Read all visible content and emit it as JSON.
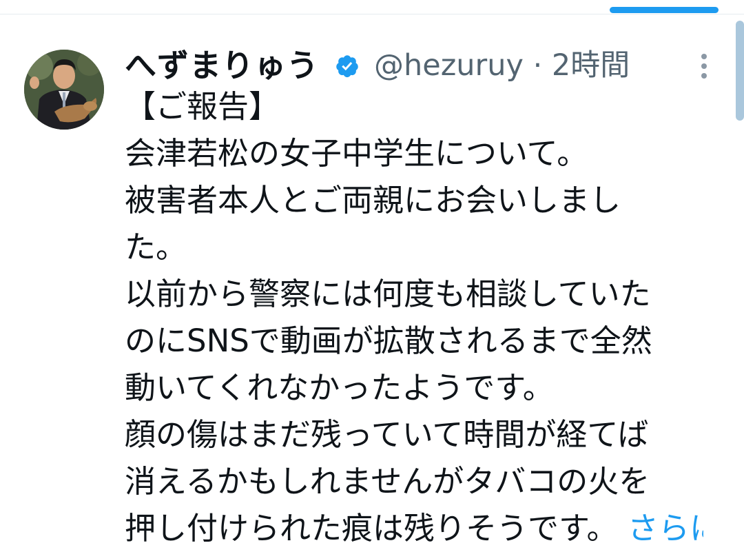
{
  "tweet": {
    "author_name": "へずまりゅう",
    "handle_time": "@hezuruy · 2時間",
    "lines": [
      "【ご報告】",
      "会津若松の女子中学生について。",
      "被害者本人とご両親にお会いしまし",
      "た。",
      "以前から警察には何度も相談していた",
      "のにSNSで動画が拡散されるまで全然",
      "動いてくれなかったようです。",
      "顔の傷はまだ残っていて時間が経てば",
      "消えるかもしれませんがタバコの火を",
      "押し付けられた痕は残りそうです。"
    ],
    "show_more_label": "さらに表示"
  },
  "icons": {
    "verified": "verified-badge-icon",
    "more": "more-options-icon"
  },
  "colors": {
    "accent": "#1d9bf0",
    "secondary_text": "#536471",
    "primary_text": "#0f1419"
  }
}
